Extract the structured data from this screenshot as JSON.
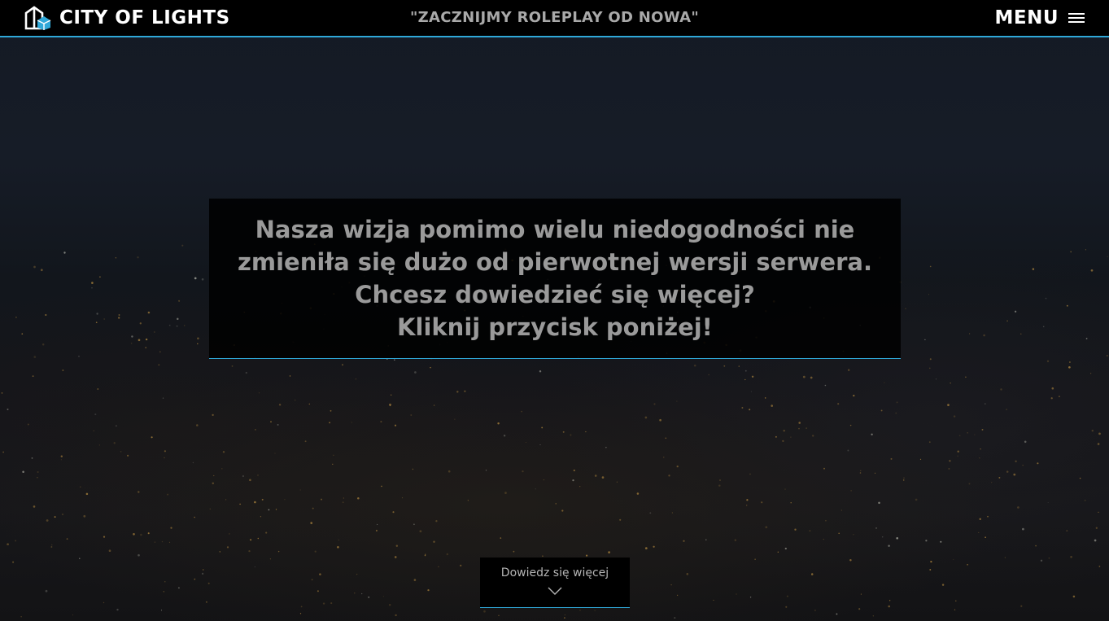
{
  "header": {
    "brand_name": "CITY OF LIGHTS",
    "brand_icon": "city-logo-icon",
    "tagline": "\"ZACZNIJMY ROLEPLAY OD NOWA\"",
    "menu_label": "MENU",
    "menu_icon": "hamburger-menu-icon"
  },
  "hero": {
    "lines": [
      "Nasza wizja pomimo wielu niedogodności nie",
      "zmieniła się dużo od pierwotnej wersji serwera.",
      "Chcesz dowiedzieć się więcej?",
      "Kliknij przycisk poniżej!"
    ]
  },
  "cta": {
    "label": "Dowiedz się więcej",
    "icon": "chevron-down-icon"
  },
  "colors": {
    "accent": "#2fa8d8",
    "header_bg": "#000000",
    "tagline_text": "#a9a9a9",
    "hero_text": "#9a9a9a"
  }
}
